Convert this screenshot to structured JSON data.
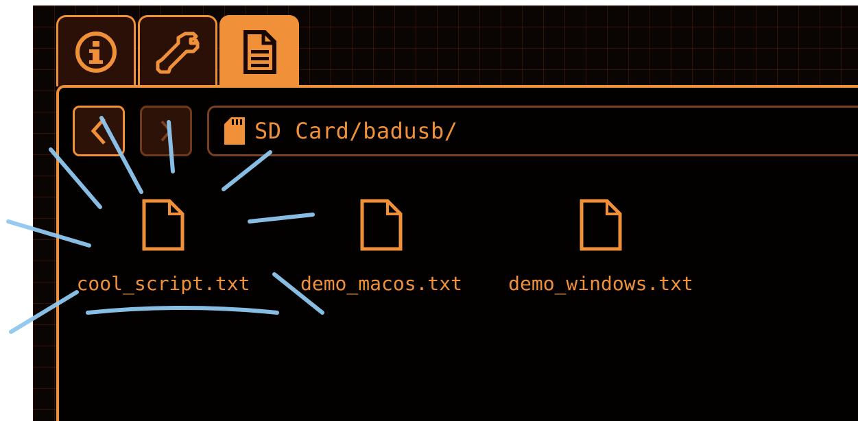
{
  "tabs": [
    {
      "icon": "info-icon",
      "active": false
    },
    {
      "icon": "wrench-icon",
      "active": false
    },
    {
      "icon": "document-icon",
      "active": true
    }
  ],
  "nav": {
    "back_icon": "chevron-left-icon",
    "forward_icon": "chevron-right-icon"
  },
  "path": {
    "icon": "sd-card-icon",
    "text": "SD Card/badusb/"
  },
  "files": [
    {
      "name": "cool_script.txt",
      "icon": "file-icon",
      "highlighted": true
    },
    {
      "name": "demo_macos.txt",
      "icon": "file-icon"
    },
    {
      "name": "demo_windows.txt",
      "icon": "file-icon"
    }
  ],
  "colors": {
    "accent": "#f0913a",
    "background": "#0a0503",
    "highlight": "#8fc8f0"
  }
}
